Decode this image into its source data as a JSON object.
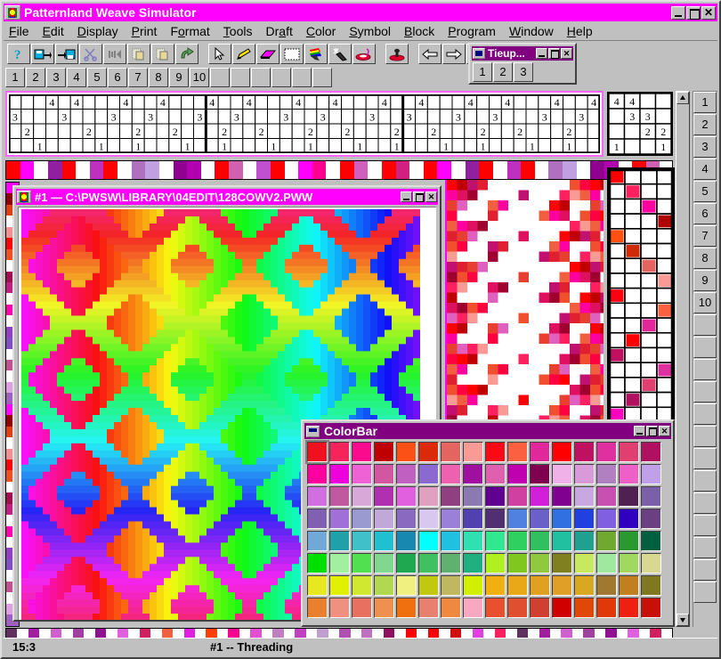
{
  "app": {
    "title": "Patternland Weave Simulator",
    "sysicon": "pattern-icon",
    "window_buttons": {
      "minimize": "_",
      "maximize": "▫",
      "close": "✕"
    }
  },
  "menubar": {
    "items": [
      {
        "label": "File",
        "accel": "F"
      },
      {
        "label": "Edit",
        "accel": "E"
      },
      {
        "label": "Display",
        "accel": "D"
      },
      {
        "label": "Print",
        "accel": "P"
      },
      {
        "label": "Format",
        "accel": "o"
      },
      {
        "label": "Tools",
        "accel": "T"
      },
      {
        "label": "Draft",
        "accel": "a"
      },
      {
        "label": "Color",
        "accel": "C"
      },
      {
        "label": "Symbol",
        "accel": "S"
      },
      {
        "label": "Block",
        "accel": "B"
      },
      {
        "label": "Program",
        "accel": "P"
      },
      {
        "label": "Window",
        "accel": "W"
      },
      {
        "label": "Help",
        "accel": "H"
      }
    ]
  },
  "toolbar": {
    "groups": [
      [
        "help-icon",
        "save-as-icon",
        "save-icon",
        "cut-icon",
        "undo-arrow-icon",
        "copy-icon",
        "paste-icon",
        "redo-icon"
      ],
      [
        "pointer-icon",
        "pencil-icon",
        "eraser-icon",
        "select-rectangle-icon",
        "paintbrush-icon",
        "magic-wand-icon",
        "lasso-icon"
      ],
      [
        "stamp-icon"
      ],
      [
        "arrow-left-icon",
        "arrow-right-icon",
        "arrow-up-icon",
        "arrow-down-icon"
      ]
    ]
  },
  "shaft_buttons": {
    "labels": [
      "1",
      "2",
      "3",
      "4",
      "5",
      "6",
      "7",
      "8",
      "9",
      "10"
    ],
    "blank_count": 6
  },
  "tieup_window": {
    "title": "Tieup...",
    "buttons": [
      "1",
      "2",
      "3"
    ]
  },
  "threading": {
    "rows": 4,
    "cols": 48,
    "row_labels": [
      "4",
      "3",
      "2",
      "1"
    ],
    "cells": [
      [
        3,
        5,
        9,
        12,
        16,
        19,
        23,
        26,
        30,
        33,
        37,
        40,
        44,
        47
      ],
      [
        0,
        4,
        8,
        11,
        15,
        18,
        22,
        25,
        29,
        32,
        36,
        39,
        43,
        46
      ],
      [
        1,
        6,
        10,
        13,
        17,
        20,
        24,
        27,
        31,
        34,
        38,
        41,
        45
      ],
      [
        2,
        7,
        10,
        14,
        17,
        21,
        24,
        28,
        31,
        35,
        38,
        42,
        45
      ]
    ]
  },
  "mini_tieup": {
    "rows": 4,
    "cols": 4,
    "values": [
      [
        "4",
        "4",
        "",
        ""
      ],
      [
        "",
        "3",
        "3",
        ""
      ],
      [
        "",
        "",
        "2",
        "2"
      ],
      [
        "1",
        "",
        "",
        "1"
      ]
    ]
  },
  "right_numbers": {
    "labels": [
      "1",
      "2",
      "3",
      "4",
      "5",
      "6",
      "7",
      "8",
      "9",
      "10"
    ],
    "blank_count": 13
  },
  "document_window": {
    "title": "#1 — C:\\PWSW\\LIBRARY\\04EDIT\\128COWV2.PWW",
    "sysicon": "pattern-icon"
  },
  "colorbar_window": {
    "title": "ColorBar",
    "sysicon": "colorbar-icon",
    "columns": 16,
    "rows": 8,
    "selected_index": 0,
    "swatches": [
      "#f01020",
      "#f5245a",
      "#fa0a8c",
      "#c00000",
      "#fb5016",
      "#dc2a08",
      "#e4645f",
      "#fa9a95",
      "#fa0a14",
      "#fb6040",
      "#e0289a",
      "#ff0000",
      "#c01060",
      "#e030a0",
      "#e04070",
      "#b01060",
      "#ff00a0",
      "#ee00dd",
      "#ef62d5",
      "#d356a0",
      "#c060c0",
      "#8a6ad0",
      "#ee60b0",
      "#a010a0",
      "#e060b0",
      "#c000b0",
      "#800050",
      "#f0b0e8",
      "#d89ad8",
      "#b080c0",
      "#ee60c8",
      "#c0a0e8",
      "#d070e0",
      "#c05aa0",
      "#d8a8d8",
      "#b030b0",
      "#e060e0",
      "#e0a0c0",
      "#904080",
      "#8a7ab0",
      "#600090",
      "#d040a0",
      "#d020d8",
      "#800090",
      "#c8a8e0",
      "#c850b0",
      "#502050",
      "#7a60a8",
      "#8060b0",
      "#a070d8",
      "#9a9ad0",
      "#c0a8d8",
      "#8a6ac0",
      "#d8c8f0",
      "#9a80d8",
      "#5040b0",
      "#503070",
      "#5080e0",
      "#6a60c8",
      "#3070e0",
      "#2040e0",
      "#8060e0",
      "#3000c0",
      "#6a4080",
      "#70a8d8",
      "#20a0a8",
      "#40c0c8",
      "#20c0d0",
      "#1888b0",
      "#00ffff",
      "#20c0e0",
      "#30e0b0",
      "#30e890",
      "#30d060",
      "#30c060",
      "#20c0a0",
      "#20a090",
      "#70a830",
      "#2a9a30",
      "#006040",
      "#00e000",
      "#a0f0a0",
      "#50e050",
      "#80d890",
      "#20a850",
      "#40c060",
      "#60b070",
      "#20b080",
      "#b0f020",
      "#80c820",
      "#90c840",
      "#808020",
      "#c8e860",
      "#a0e8a0",
      "#a0d860",
      "#d8d890",
      "#e8e820",
      "#e0f000",
      "#d0e830",
      "#b0d850",
      "#f0f080",
      "#c0c810",
      "#c0b860",
      "#d0f000",
      "#f0b010",
      "#e8a818",
      "#e0a020",
      "#e0a028",
      "#d8a820",
      "#a07830",
      "#c08020",
      "#807820",
      "#e88030",
      "#f09080",
      "#e87060",
      "#f09050",
      "#f07010",
      "#e88070",
      "#f08840",
      "#f8a8c0",
      "#e85030",
      "#e05030",
      "#d04030",
      "#d00000",
      "#e04808",
      "#e03808",
      "#f02010",
      "#c81008"
    ]
  },
  "warp_strip": {
    "colors": [
      "#ff0000",
      "#ff00ff",
      "#c040c0",
      "#9020a0",
      "#ff0000",
      "#d050c0",
      "#c030c0",
      "#ff0000",
      "#ff0000",
      "#b070c0",
      "#c0a0e0",
      "#ff0000",
      "#900090",
      "#b000b0",
      "#ff0000",
      "#ff0000",
      "#d060b0",
      "#9070c0",
      "#c050d0",
      "#ff0000",
      "#ff0000",
      "#ff00ff",
      "#ff0090",
      "#ff0000",
      "#ff0000",
      "#d060c0",
      "#ff0000",
      "#ff0000",
      "#d02080",
      "#ff0000"
    ]
  },
  "weft_strip": {
    "colors": [
      "#ff00ff",
      "#900000",
      "#e04010",
      "#ffffff",
      "#f09090",
      "#ff0000",
      "#f05020",
      "#ffffff",
      "#a01050",
      "#c02080",
      "#ffffff",
      "#ff00aa",
      "#ffffff",
      "#9040c0",
      "#8050c0",
      "#ffffff",
      "#c05090",
      "#ffffff",
      "#e0a0e0",
      "#a060c0"
    ]
  },
  "bottom_strip": {
    "colors": [
      "#603060",
      "#c080c0",
      "#a020a0",
      "#c040c0",
      "#d060d0",
      "#c0a0d0",
      "#a040a0",
      "#b050b0",
      "#901090",
      "#c070c0",
      "#e060e0",
      "#901060",
      "#d02060",
      "#ff0000",
      "#f06040",
      "#ff0000",
      "#e020e0",
      "#d01010",
      "#ff4000",
      "#e040e0",
      "#ff0090",
      "#ff2060",
      "#e050d0"
    ]
  },
  "statusbar": {
    "left": "15:3",
    "center": "#1 -- Threading"
  },
  "colors": {
    "title_active": "#ff00ff",
    "title_secondary": "#800080",
    "face": "#c0c0c0",
    "grid_border": "#ff66ff"
  }
}
